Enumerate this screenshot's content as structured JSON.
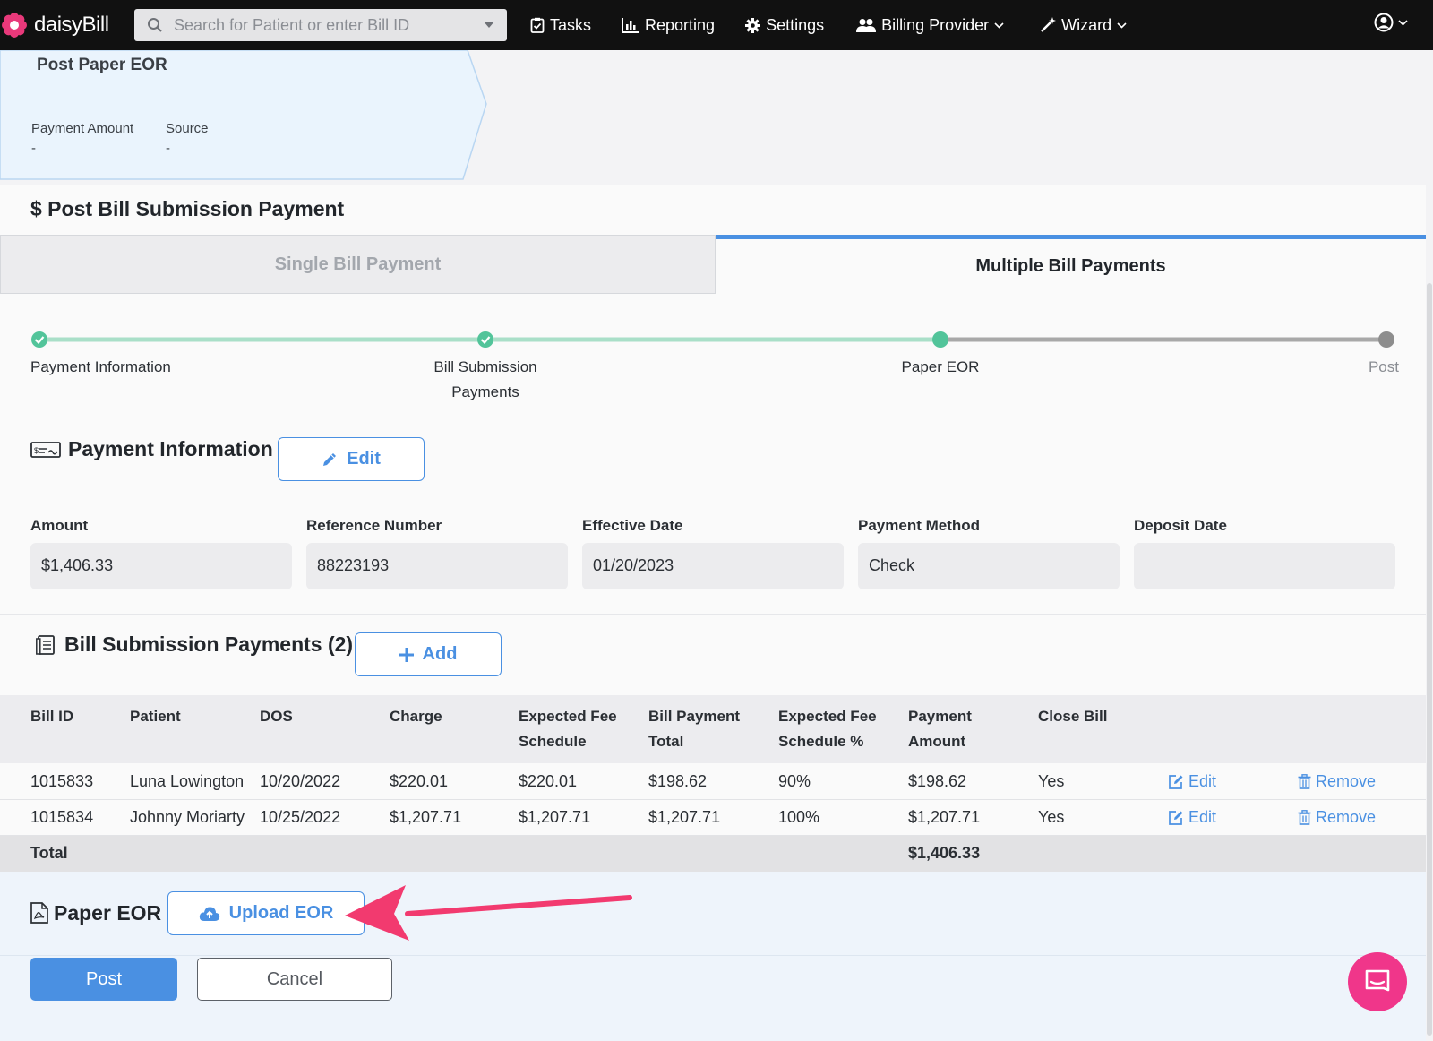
{
  "nav": {
    "brand": "daisyBill",
    "search_placeholder": "Search for Patient or enter Bill ID",
    "items": [
      {
        "label": "Tasks",
        "icon": "clipboard-check-icon"
      },
      {
        "label": "Reporting",
        "icon": "bar-chart-icon"
      },
      {
        "label": "Settings",
        "icon": "gear-icon"
      },
      {
        "label": "Billing Provider",
        "icon": "users-icon"
      },
      {
        "label": "Wizard",
        "icon": "magic-wand-icon"
      }
    ],
    "colors": {
      "bar": "#111111",
      "brand_flower": "#e8397a"
    }
  },
  "step_card": {
    "title": "Post Paper EOR",
    "payment_amount_label": "Payment Amount",
    "payment_amount_value": "-",
    "source_label": "Source",
    "source_value": "-"
  },
  "panel": {
    "title": "$ Post Bill Submission Payment",
    "tabs": [
      {
        "label": "Single Bill Payment",
        "active": false
      },
      {
        "label": "Multiple Bill Payments",
        "active": true
      }
    ]
  },
  "progress": {
    "steps": [
      {
        "label_line1": "Payment Information",
        "label_line2": "",
        "state": "done"
      },
      {
        "label_line1": "Bill Submission",
        "label_line2": "Payments",
        "state": "done"
      },
      {
        "label_line1": "Paper EOR",
        "label_line2": "",
        "state": "current"
      },
      {
        "label_line1": "Post",
        "label_line2": "",
        "state": "pending"
      }
    ],
    "colors": {
      "done": "#52c49a",
      "pending": "#a0a0a0"
    }
  },
  "payment_info": {
    "title": "Payment Information",
    "edit_label": "Edit",
    "fields": [
      {
        "label": "Amount",
        "value": "$1,406.33"
      },
      {
        "label": "Reference Number",
        "value": "88223193"
      },
      {
        "label": "Effective Date",
        "value": "01/20/2023"
      },
      {
        "label": "Payment Method",
        "value": "Check"
      },
      {
        "label": "Deposit Date",
        "value": ""
      }
    ]
  },
  "bill_payments": {
    "title": "Bill Submission Payments (2)",
    "add_label": "Add",
    "columns": [
      {
        "line1": "Bill ID",
        "line2": ""
      },
      {
        "line1": "Patient",
        "line2": ""
      },
      {
        "line1": "DOS",
        "line2": ""
      },
      {
        "line1": "Charge",
        "line2": ""
      },
      {
        "line1": "Expected Fee",
        "line2": "Schedule"
      },
      {
        "line1": "Bill Payment",
        "line2": "Total"
      },
      {
        "line1": "Expected Fee",
        "line2": "Schedule %"
      },
      {
        "line1": "Payment",
        "line2": "Amount"
      },
      {
        "line1": "Close Bill",
        "line2": ""
      }
    ],
    "rows": [
      {
        "bill_id": "1015833",
        "patient": "Luna Lowington",
        "dos": "10/20/2022",
        "charge": "$220.01",
        "expected_fee": "$220.01",
        "bill_payment_total": "$198.62",
        "expected_pct": "90%",
        "payment_amount": "$198.62",
        "close_bill": "Yes",
        "edit": "Edit",
        "remove": "Remove"
      },
      {
        "bill_id": "1015834",
        "patient": "Johnny Moriarty",
        "dos": "10/25/2022",
        "charge": "$1,207.71",
        "expected_fee": "$1,207.71",
        "bill_payment_total": "$1,207.71",
        "expected_pct": "100%",
        "payment_amount": "$1,207.71",
        "close_bill": "Yes",
        "edit": "Edit",
        "remove": "Remove"
      }
    ],
    "total_label": "Total",
    "total_amount": "$1,406.33"
  },
  "paper_eor": {
    "title": "Paper EOR",
    "upload_label": "Upload EOR"
  },
  "actions": {
    "post_label": "Post",
    "cancel_label": "Cancel"
  },
  "accent": "#4a90e2",
  "annotation_arrow_color": "#f23a6f",
  "chat_bubble_color": "#f0368a"
}
